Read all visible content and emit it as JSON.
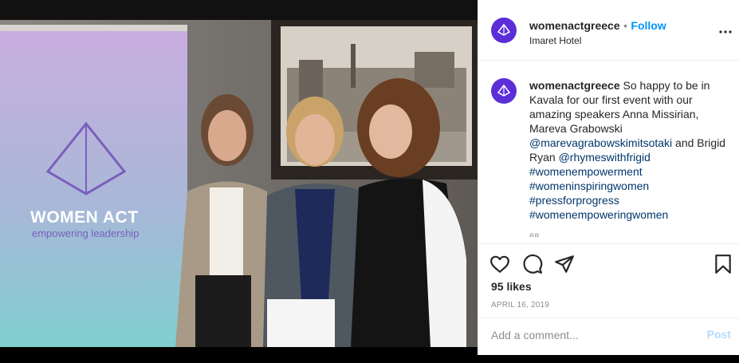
{
  "post": {
    "username": "womenactgreece",
    "follow_sep": "•",
    "follow_label": "Follow",
    "location": "Imaret Hotel",
    "more_icon": "more-horizontal-icon",
    "caption": {
      "username": "womenactgreece",
      "text_1": "So happy to be in Kavala for our first event with our amazing speakers Anna Missirian, Mareva Grabowski",
      "mention_1": "@marevagrabowskimitsotaki",
      "text_2": "and Brigid Ryan",
      "mention_2": "@rhymeswithfrigid",
      "hashtags": [
        "#womenempowerment",
        "#womeninspiringwomen",
        "#pressforprogress",
        "#womenempoweringwomen"
      ],
      "more": "68..."
    },
    "likes": "95 likes",
    "date": "APRIL 16, 2019",
    "comment_placeholder": "Add a comment...",
    "post_label": "Post"
  },
  "photo": {
    "banner_title": "WOMEN ACT",
    "banner_tagline": "empowering leadership"
  },
  "colors": {
    "brand_purple": "#5b2ed8",
    "link_blue": "#0095f6",
    "hashtag": "#00376b",
    "post_disabled": "#b3dbff"
  }
}
